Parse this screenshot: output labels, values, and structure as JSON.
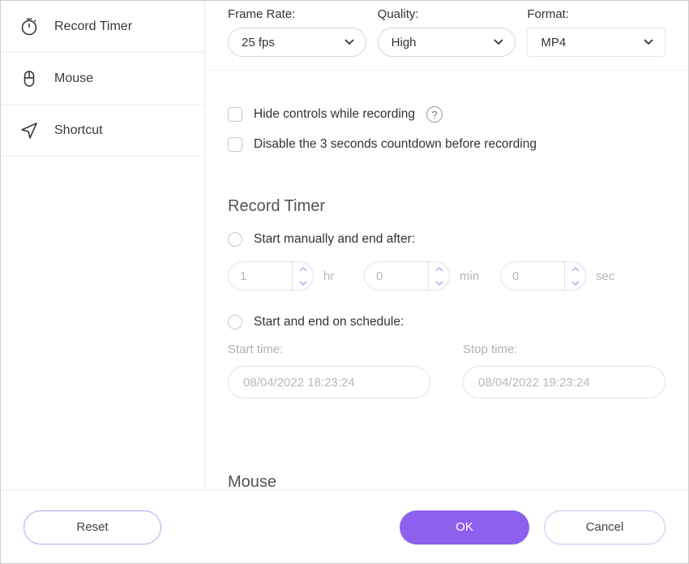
{
  "sidebar": {
    "items": [
      {
        "label": "Record Timer"
      },
      {
        "label": "Mouse"
      },
      {
        "label": "Shortcut"
      }
    ]
  },
  "top": {
    "frameRate": {
      "label": "Frame Rate:",
      "value": "25 fps"
    },
    "quality": {
      "label": "Quality:",
      "value": "High"
    },
    "format": {
      "label": "Format:",
      "value": "MP4"
    }
  },
  "options": {
    "hideControls": "Hide controls while recording",
    "disableCountdown": "Disable the 3 seconds countdown before recording"
  },
  "timer": {
    "title": "Record Timer",
    "manual": {
      "label": "Start manually and end after:",
      "hr": {
        "value": "1",
        "unit": "hr"
      },
      "min": {
        "value": "0",
        "unit": "min"
      },
      "sec": {
        "value": "0",
        "unit": "sec"
      }
    },
    "schedule": {
      "label": "Start and end on schedule:",
      "startLabel": "Start time:",
      "stopLabel": "Stop time:",
      "startValue": "08/04/2022 18:23:24",
      "stopValue": "08/04/2022 19:23:24"
    }
  },
  "mouse": {
    "title": "Mouse"
  },
  "footer": {
    "reset": "Reset",
    "ok": "OK",
    "cancel": "Cancel"
  }
}
